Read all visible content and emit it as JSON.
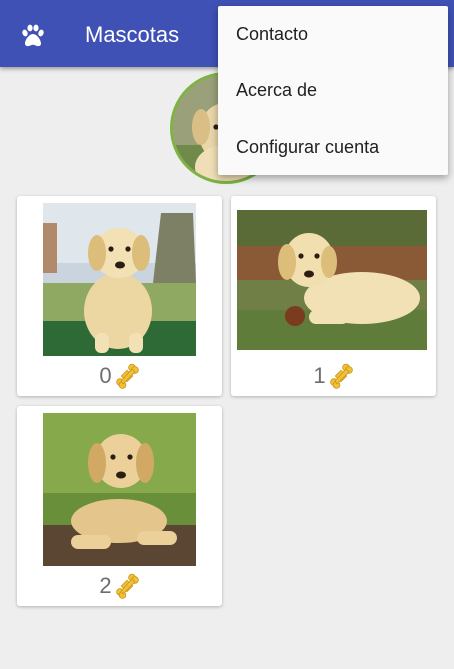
{
  "app_bar": {
    "title": "Mascotas",
    "icon": "paw-icon",
    "color": "#3f51b5"
  },
  "overflow_menu": {
    "items": [
      "Contacto",
      "Acerca de",
      "Configurar cuenta"
    ]
  },
  "profile": {
    "avatar": "puppy-photo"
  },
  "pets": [
    {
      "image": "yellow-lab-puppy-sitting-photo",
      "likes": "0",
      "like_icon": "bone-icon"
    },
    {
      "image": "yellow-lab-puppy-lying-on-grass-photo",
      "likes": "1",
      "like_icon": "bone-icon"
    },
    {
      "image": "yellow-lab-puppy-on-log-photo",
      "likes": "2",
      "like_icon": "bone-icon"
    }
  ],
  "colors": {
    "app_bar": "#3f51b5",
    "avatar_border": "#7cb342",
    "bone": "#f2c037"
  }
}
